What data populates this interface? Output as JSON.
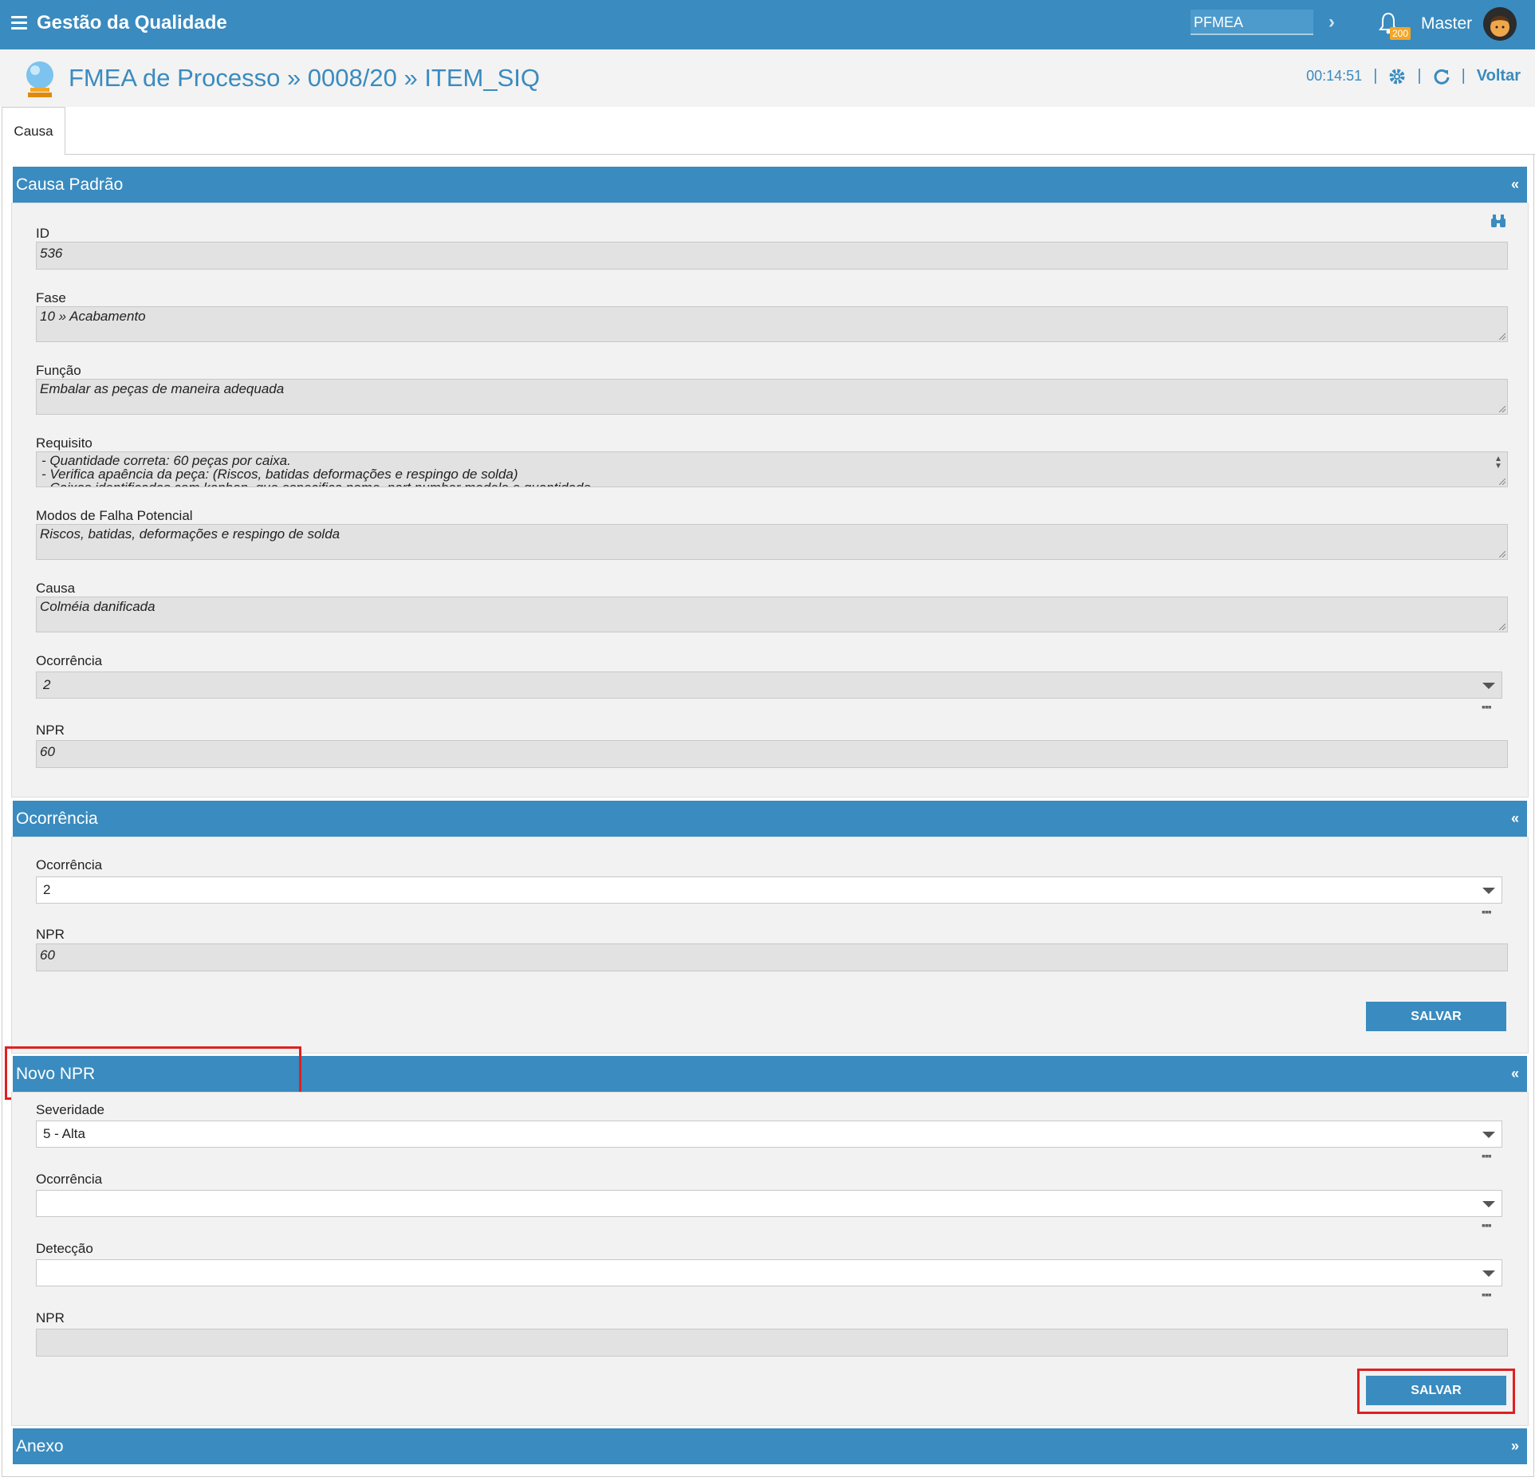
{
  "topbar": {
    "app_title": "Gestão da Qualidade",
    "module_value": "PFMEA",
    "notification_count": "200",
    "user_name": "Master"
  },
  "header": {
    "title": "FMEA de Processo » 0008/20 » ITEM_SIQ",
    "timer": "00:14:51",
    "back_label": "Voltar"
  },
  "tabs": [
    {
      "label": "Causa"
    }
  ],
  "causa_padrao": {
    "title": "Causa Padrão",
    "collapse": "«",
    "id_label": "ID",
    "id_value": "536",
    "fase_label": "Fase",
    "fase_value": "10 » Acabamento",
    "funcao_label": "Função",
    "funcao_value": "Embalar as peças de maneira adequada",
    "requisito_label": "Requisito",
    "requisito_lines": [
      "- Quantidade correta: 60 peças por caixa.",
      "- Verifica apaência da peça: (Riscos, batidas deformações e respingo de solda)",
      "- Caixas identificadas com kanban, que especifica nome, part number modelo e quantidade"
    ],
    "modos_label": "Modos de Falha Potencial",
    "modos_value": "Riscos, batidas, deformações e respingo de solda",
    "causa_label": "Causa",
    "causa_value": "Colméia danificada",
    "ocorrencia_label": "Ocorrência",
    "ocorrencia_value": "2",
    "npr_label": "NPR",
    "npr_value": "60"
  },
  "ocorrencia_section": {
    "title": "Ocorrência",
    "collapse": "«",
    "ocorrencia_label": "Ocorrência",
    "ocorrencia_value": "2",
    "npr_label": "NPR",
    "npr_value": "60",
    "save_label": "SALVAR"
  },
  "novo_npr": {
    "title": "Novo NPR",
    "collapse": "«",
    "severidade_label": "Severidade",
    "severidade_value": "5 - Alta",
    "ocorrencia_label": "Ocorrência",
    "ocorrencia_value": "",
    "deteccao_label": "Detecção",
    "deteccao_value": "",
    "npr_label": "NPR",
    "npr_value": "",
    "save_label": "SALVAR"
  },
  "anexo": {
    "title": "Anexo",
    "expand": "»"
  },
  "colors": {
    "primary": "#3a8bbf",
    "highlight": "#e02020",
    "badge": "#f5a623"
  }
}
